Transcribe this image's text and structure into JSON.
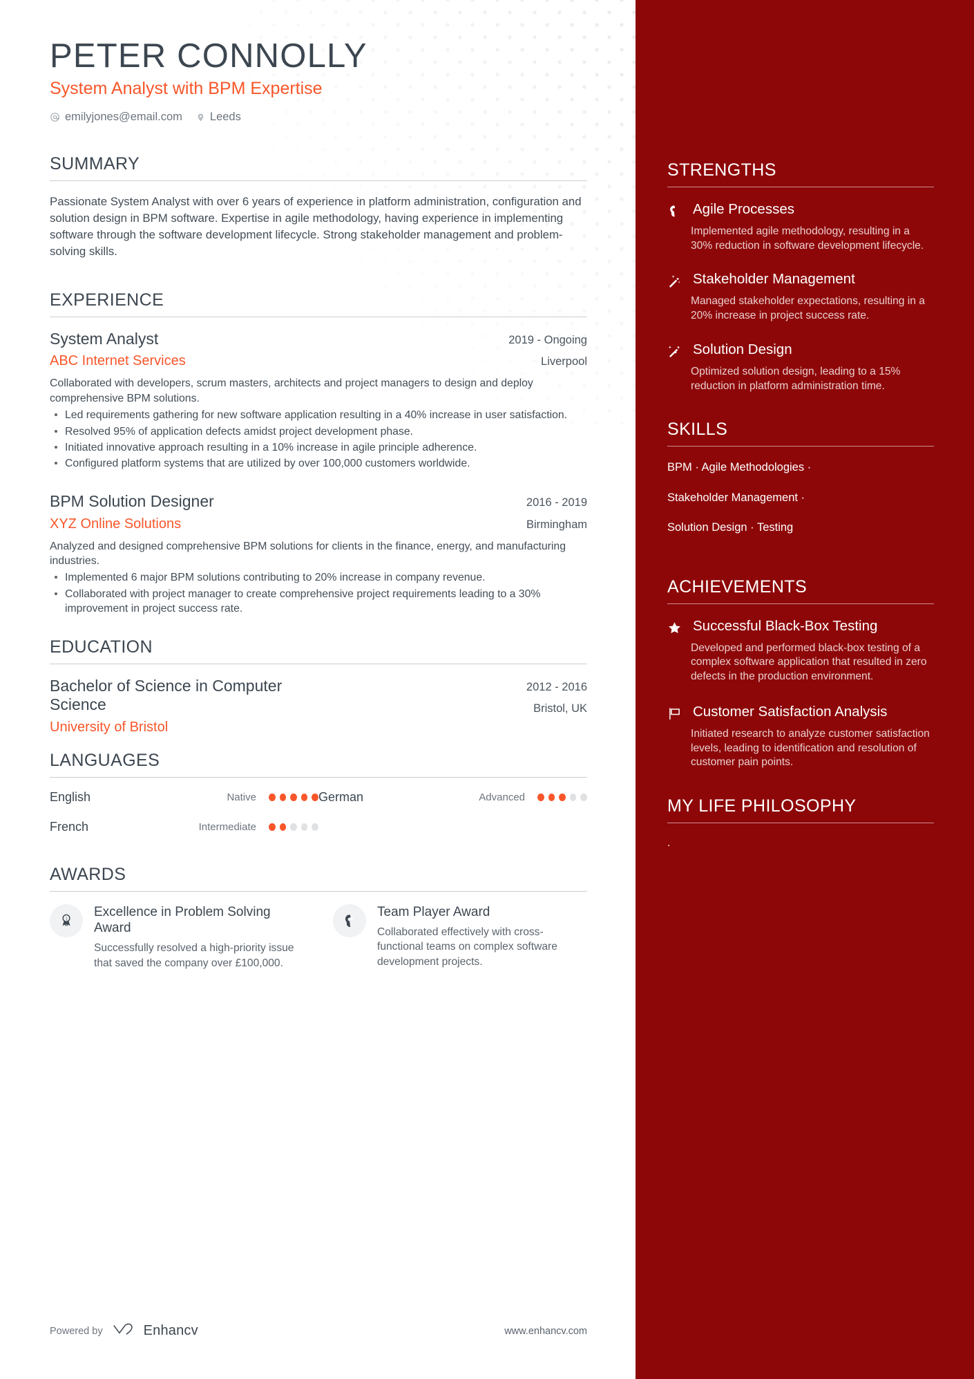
{
  "accent_orange": "#f8562a",
  "panel_red": "#8d0709",
  "ink": "#3c4650",
  "header": {
    "name": "PETER CONNOLLY",
    "role": "System Analyst with BPM Expertise",
    "contacts": [
      {
        "icon": "at-icon",
        "text": "emilyjones@email.com"
      },
      {
        "icon": "location-pin-icon",
        "text": "Leeds"
      }
    ]
  },
  "summary": {
    "title": "SUMMARY",
    "text": "Passionate System Analyst with over 6 years of experience in platform administration, configuration and solution design in BPM software. Expertise in agile methodology, having experience in implementing software through the software development lifecycle. Strong stakeholder management and problem-solving skills."
  },
  "experience": {
    "title": "EXPERIENCE",
    "entries": [
      {
        "role": "System Analyst",
        "org": "ABC Internet Services",
        "date": "2019 - Ongoing",
        "location": "Liverpool",
        "desc": "Collaborated with developers, scrum masters, architects and project managers to design and deploy comprehensive BPM solutions.",
        "bullets": [
          "Led requirements gathering for new software application resulting in a 40% increase in user satisfaction.",
          "Resolved 95% of application defects amidst project development phase.",
          "Initiated innovative approach resulting in a 10% increase in agile principle adherence.",
          "Configured platform systems that are utilized by over 100,000 customers worldwide."
        ]
      },
      {
        "role": "BPM Solution Designer",
        "org": "XYZ Online Solutions",
        "date": "2016 - 2019",
        "location": "Birmingham",
        "desc": "Analyzed and designed comprehensive BPM solutions for clients in the finance, energy, and manufacturing industries.",
        "bullets": [
          "Implemented 6 major BPM solutions contributing to 20% increase in company revenue.",
          "Collaborated with project manager to create comprehensive project requirements leading to a 30% improvement in project success rate."
        ]
      }
    ]
  },
  "education": {
    "title": "EDUCATION",
    "entries": [
      {
        "degree": "Bachelor of Science in Computer Science",
        "school": "University of Bristol",
        "date": "2012 - 2016",
        "location": "Bristol, UK"
      }
    ]
  },
  "languages": {
    "title": "LANGUAGES",
    "items": [
      {
        "name": "English",
        "level": "Native",
        "rating": 5,
        "max": 5
      },
      {
        "name": "German",
        "level": "Advanced",
        "rating": 3,
        "max": 5
      },
      {
        "name": "French",
        "level": "Intermediate",
        "rating": 2,
        "max": 5
      }
    ]
  },
  "awards": {
    "title": "AWARDS",
    "items": [
      {
        "icon": "award-ribbon-icon",
        "title": "Excellence in Problem Solving Award",
        "desc": "Successfully resolved a high-priority issue that saved the company over £100,000."
      },
      {
        "icon": "head-profile-icon",
        "title": "Team Player Award",
        "desc": "Collaborated effectively with cross-functional teams on complex software development projects."
      }
    ]
  },
  "footer": {
    "powered_label": "Powered by",
    "brand": "Enhancv",
    "brand_icon": "enhancv-logo-icon",
    "website": "www.enhancv.com"
  },
  "strengths": {
    "title": "STRENGTHS",
    "items": [
      {
        "icon": "head-idea-icon",
        "title": "Agile Processes",
        "desc": "Implemented agile methodology, resulting in a 30% reduction in software development lifecycle."
      },
      {
        "icon": "magic-wand-icon",
        "title": "Stakeholder Management",
        "desc": "Managed stakeholder expectations, resulting in a 20% increase in project success rate."
      },
      {
        "icon": "sparkle-arrow-icon",
        "title": "Solution Design",
        "desc": "Optimized solution design, leading to a 15% reduction in platform administration time."
      }
    ]
  },
  "skills": {
    "title": "SKILLS",
    "lines": [
      "BPM · Agile Methodologies ·",
      "Stakeholder Management ·",
      "Solution Design · Testing"
    ]
  },
  "achievements": {
    "title": "ACHIEVEMENTS",
    "items": [
      {
        "icon": "star-icon",
        "title": "Successful Black-Box Testing",
        "desc": "Developed and performed black-box testing of a complex software application that resulted in zero defects in the production environment."
      },
      {
        "icon": "flag-icon",
        "title": "Customer Satisfaction Analysis",
        "desc": "Initiated research to analyze customer satisfaction levels, leading to identification and resolution of customer pain points."
      }
    ]
  },
  "philosophy": {
    "title": "MY LIFE PHILOSOPHY",
    "text": "."
  }
}
